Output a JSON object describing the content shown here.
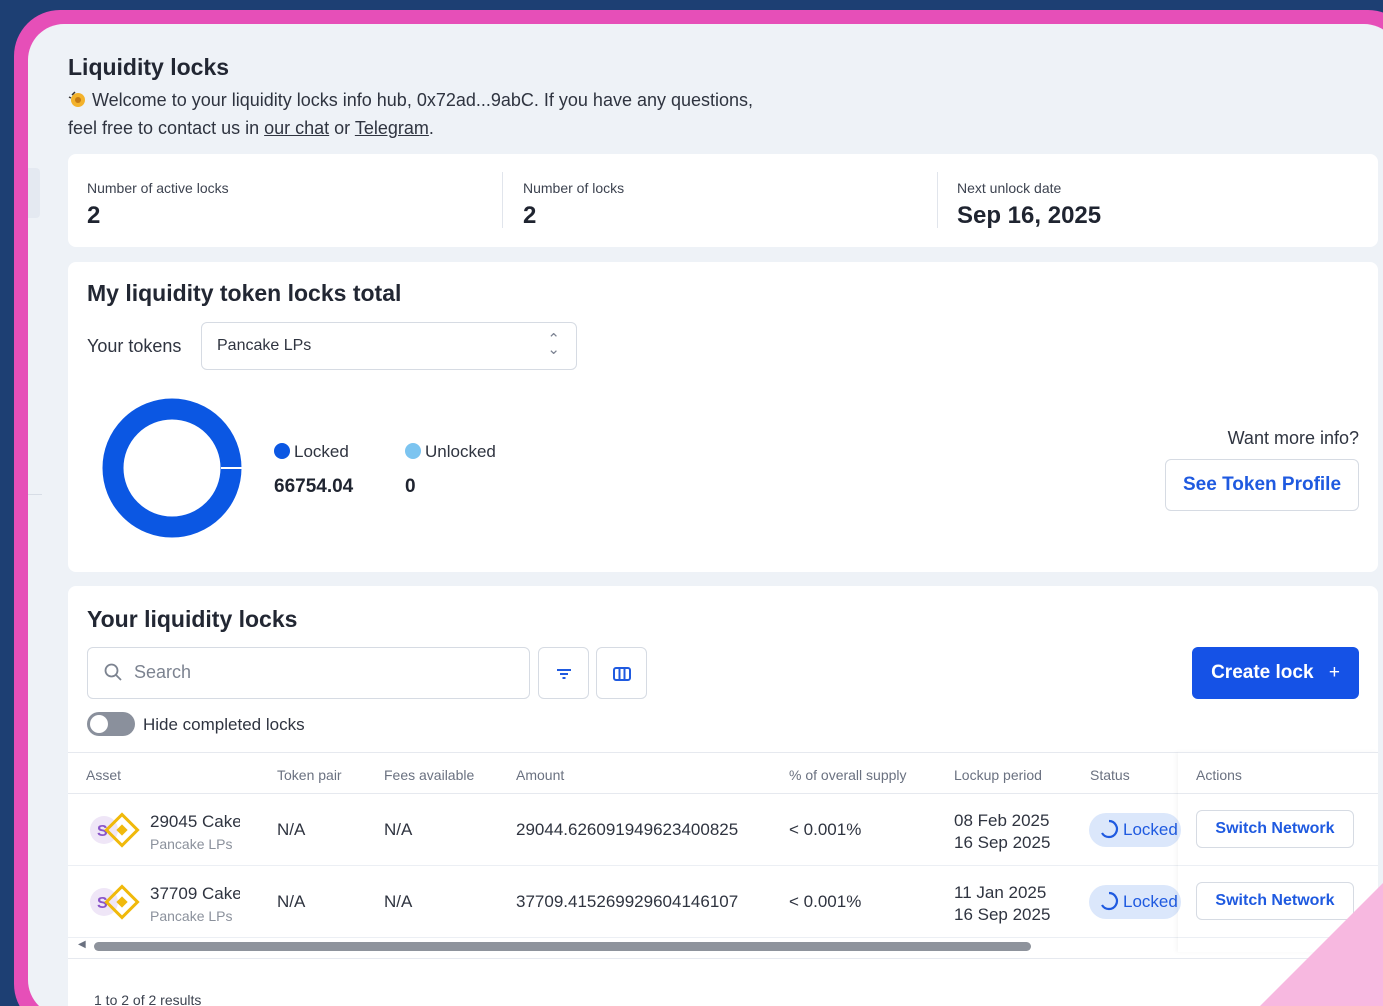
{
  "page": {
    "title": "Liquidity locks",
    "welcome_text": "Welcome to your liquidity locks info hub, 0x72ad...9abC. If you have any questions, feel free to contact us in ",
    "welcome_link_chat": "our chat",
    "welcome_or": " or ",
    "welcome_link_telegram": "Telegram",
    "welcome_end": "."
  },
  "stats": [
    {
      "label": "Number of active locks",
      "value": "2"
    },
    {
      "label": "Number of locks",
      "value": "2"
    },
    {
      "label": "Next unlock date",
      "value": "Sep 16, 2025"
    }
  ],
  "token_total": {
    "title": "My liquidity token locks total",
    "tokens_label": "Your tokens",
    "selected_token": "Pancake LPs",
    "legend": [
      {
        "label": "Locked",
        "value": "66754.04",
        "color": "#0b57e3"
      },
      {
        "label": "Unlocked",
        "value": "0",
        "color": "#7cc4f0"
      }
    ],
    "locked_fraction": 1.0,
    "more_info": "Want more info?",
    "profile_button": "See Token Profile"
  },
  "locks": {
    "title": "Your liquidity locks",
    "search_placeholder": "Search",
    "create_button": "Create lock",
    "create_icon": "+",
    "hide_completed_label": "Hide completed locks",
    "columns": [
      "Asset",
      "Token pair",
      "Fees available",
      "Amount",
      "% of overall supply",
      "Lockup period",
      "Status",
      "Actions"
    ],
    "rows": [
      {
        "asset_name": "29045 Cake",
        "asset_sub": "Pancake LPs",
        "token_pair": "N/A",
        "fees": "N/A",
        "amount": "29044.626091949623400825",
        "supply": "< 0.001%",
        "period_start": "08 Feb 2025",
        "period_end": "16 Sep 2025",
        "status": "Locked",
        "action": "Switch Network"
      },
      {
        "asset_name": "37709 Cake",
        "asset_sub": "Pancake LPs",
        "token_pair": "N/A",
        "fees": "N/A",
        "amount": "37709.415269929604146107",
        "supply": "< 0.001%",
        "period_start": "11 Jan 2025",
        "period_end": "16 Sep 2025",
        "status": "Locked",
        "action": "Switch Network"
      }
    ],
    "results_text": "1 to 2 of 2 results"
  },
  "colors": {
    "accent": "#1552e6",
    "frame": "#e64fb8",
    "background": "#1d3f73"
  }
}
